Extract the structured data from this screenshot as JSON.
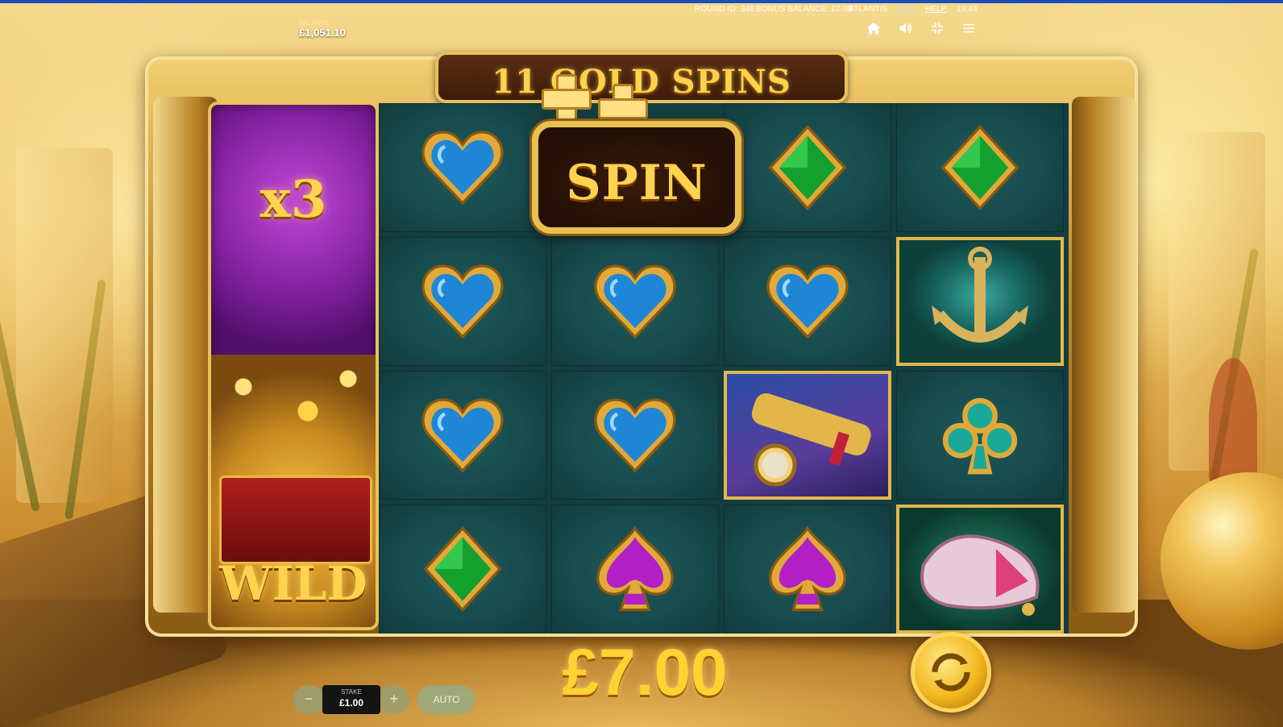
{
  "hud": {
    "round_id": "ROUND ID: 348",
    "bonus_balance": "BONUS BALANCE: £0.00",
    "game_name": "ATLANTIS",
    "pays": "PAYS",
    "help": "HELP",
    "clock": "13:44"
  },
  "balance": {
    "label": "BALANCE",
    "value": "£1,051.10"
  },
  "icons": [
    "home-icon",
    "sound-icon",
    "fullscreen-exit-icon",
    "menu-icon"
  ],
  "banner": {
    "text": "11 GOLD SPINS"
  },
  "wild_reel": {
    "multiplier": "x3",
    "label": "WILD"
  },
  "spin_bonus": {
    "text": "SPIN"
  },
  "reels": [
    [
      "heart-blue",
      "spin-bonus",
      "diamond-green",
      "diamond-green"
    ],
    [
      "heart-blue",
      "heart-blue",
      "heart-blue",
      "anchor"
    ],
    [
      "heart-blue",
      "heart-blue",
      "telescope",
      "club-teal"
    ],
    [
      "diamond-green",
      "spade-purple",
      "spade-purple",
      "shell"
    ]
  ],
  "win": {
    "amount": "£7.00"
  },
  "stake": {
    "label": "STAKE",
    "value": "£1.00",
    "minus": "−",
    "plus": "+"
  },
  "auto": {
    "label": "AUTO"
  },
  "colors": {
    "accent_gold": "#ffd233",
    "reel_bg": "#174a4c",
    "wild_purple": "#7a1d99"
  }
}
